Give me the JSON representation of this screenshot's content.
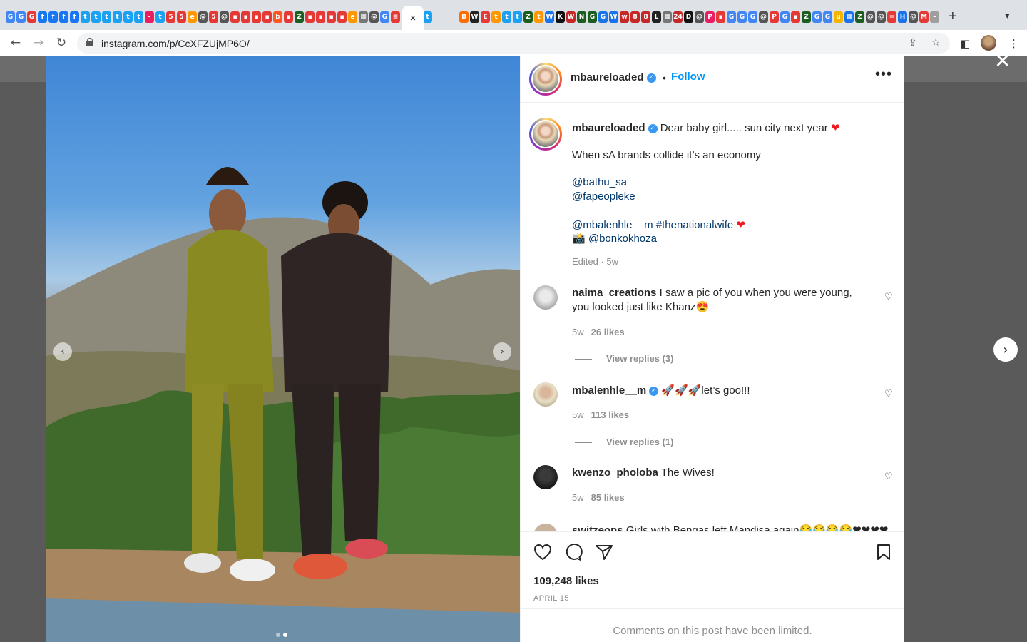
{
  "browser": {
    "url": "instagram.com/p/CcXFZUjMP6O/",
    "close_tab": "×",
    "new_tab": "+",
    "tab_menu": "⌄",
    "tab_favicons": [
      {
        "c": "#4285f4",
        "g": "G"
      },
      {
        "c": "#4285f4",
        "g": "G"
      },
      {
        "c": "#e53935",
        "g": "G"
      },
      {
        "c": "#1877f2",
        "g": "f"
      },
      {
        "c": "#1877f2",
        "g": "f"
      },
      {
        "c": "#1877f2",
        "g": "f"
      },
      {
        "c": "#1877f2",
        "g": "f"
      },
      {
        "c": "#1da1f2",
        "g": "t"
      },
      {
        "c": "#1da1f2",
        "g": "t"
      },
      {
        "c": "#1da1f2",
        "g": "t"
      },
      {
        "c": "#1da1f2",
        "g": "t"
      },
      {
        "c": "#1da1f2",
        "g": "t"
      },
      {
        "c": "#1da1f2",
        "g": "t"
      },
      {
        "c": "#e91e63",
        "g": "-"
      },
      {
        "c": "#1da1f2",
        "g": "t"
      },
      {
        "c": "#e53935",
        "g": "5"
      },
      {
        "c": "#e53935",
        "g": "5"
      },
      {
        "c": "#ff9800",
        "g": "e"
      },
      {
        "c": "#555555",
        "g": "@"
      },
      {
        "c": "#e53935",
        "g": "5"
      },
      {
        "c": "#555555",
        "g": "@"
      },
      {
        "c": "#e53935",
        "g": "▪"
      },
      {
        "c": "#e53935",
        "g": "▪"
      },
      {
        "c": "#e53935",
        "g": "▪"
      },
      {
        "c": "#e53935",
        "g": "▪"
      },
      {
        "c": "#ff5722",
        "g": "b"
      },
      {
        "c": "#e53935",
        "g": "▪"
      },
      {
        "c": "#1b5e20",
        "g": "Z"
      },
      {
        "c": "#e53935",
        "g": "▪"
      },
      {
        "c": "#e53935",
        "g": "▪"
      },
      {
        "c": "#e53935",
        "g": "▪"
      },
      {
        "c": "#e53935",
        "g": "▪"
      },
      {
        "c": "#ff9800",
        "g": "e"
      },
      {
        "c": "#777777",
        "g": "▦"
      },
      {
        "c": "#555555",
        "g": "@"
      },
      {
        "c": "#4285f4",
        "g": "G"
      },
      {
        "c": "#e53935",
        "g": "≡"
      },
      {
        "c": "#f4b400",
        "g": "a"
      },
      {
        "c": "#555555",
        "g": "@"
      },
      {
        "c": "#1da1f2",
        "g": "t"
      }
    ],
    "tab_favicons_right": [
      {
        "c": "#ff6f00",
        "g": "B"
      },
      {
        "c": "#222222",
        "g": "W"
      },
      {
        "c": "#e53935",
        "g": "E"
      },
      {
        "c": "#ff9800",
        "g": "t"
      },
      {
        "c": "#1da1f2",
        "g": "t"
      },
      {
        "c": "#1da1f2",
        "g": "t"
      },
      {
        "c": "#1b5e20",
        "g": "Z"
      },
      {
        "c": "#ff9800",
        "g": "t"
      },
      {
        "c": "#1a73e8",
        "g": "W"
      },
      {
        "c": "#111111",
        "g": "K"
      },
      {
        "c": "#c62828",
        "g": "W"
      },
      {
        "c": "#1b5e20",
        "g": "N"
      },
      {
        "c": "#1b5e20",
        "g": "G"
      },
      {
        "c": "#1a73e8",
        "g": "G"
      },
      {
        "c": "#1a73e8",
        "g": "W"
      },
      {
        "c": "#c62828",
        "g": "w"
      },
      {
        "c": "#c62828",
        "g": "8"
      },
      {
        "c": "#c62828",
        "g": "8"
      },
      {
        "c": "#222222",
        "g": "L"
      },
      {
        "c": "#777777",
        "g": "▦"
      },
      {
        "c": "#c62828",
        "g": "24"
      },
      {
        "c": "#111111",
        "g": "D"
      },
      {
        "c": "#555555",
        "g": "@"
      },
      {
        "c": "#e91e63",
        "g": "P"
      },
      {
        "c": "#e53935",
        "g": "▪"
      },
      {
        "c": "#4285f4",
        "g": "G"
      },
      {
        "c": "#4285f4",
        "g": "G"
      },
      {
        "c": "#4285f4",
        "g": "G"
      },
      {
        "c": "#555555",
        "g": "@"
      },
      {
        "c": "#e53935",
        "g": "P"
      },
      {
        "c": "#4285f4",
        "g": "G"
      },
      {
        "c": "#e53935",
        "g": "▪"
      },
      {
        "c": "#1b5e20",
        "g": "Z"
      },
      {
        "c": "#4285f4",
        "g": "G"
      },
      {
        "c": "#4285f4",
        "g": "G"
      },
      {
        "c": "#f4b400",
        "g": "u"
      },
      {
        "c": "#1a73e8",
        "g": "▦"
      },
      {
        "c": "#1b5e20",
        "g": "Z"
      },
      {
        "c": "#555555",
        "g": "@"
      },
      {
        "c": "#555555",
        "g": "@"
      },
      {
        "c": "#e53935",
        "g": "="
      },
      {
        "c": "#1a73e8",
        "g": "H"
      },
      {
        "c": "#555555",
        "g": "@"
      },
      {
        "c": "#e53935",
        "g": "M"
      },
      {
        "c": "#9e9e9e",
        "g": "–"
      },
      {
        "c": "#c62828",
        "g": "m"
      },
      {
        "c": "#2e7d32",
        "g": "25"
      },
      {
        "c": "#111111",
        "g": "B"
      }
    ]
  },
  "post": {
    "username": "mbaureloaded",
    "follow_label": "Follow",
    "separator": "•",
    "more_label": "•••",
    "caption": {
      "line1": "Dear baby girl..... sun city next year",
      "line2": "When sA brands collide it’s an economy",
      "mention1": "@bathu_sa",
      "mention2": "@fapeopleke",
      "mention3": "@mbalenhle__m",
      "hashtag": "#thenationalwife",
      "camera": "📸",
      "mention4": "@bonkokhoza",
      "heart": "❤",
      "meta": "Edited · 5w"
    },
    "comments": [
      {
        "user": "naima_creations",
        "text1": "I saw a pic of you when you were young,",
        "text2": "you looked just like Khanz😍",
        "age": "5w",
        "likes": "26 likes",
        "replies": "View replies (3)"
      },
      {
        "user": "mbalenhle__m",
        "text1": "🚀🚀🚀let’s goo!!!",
        "age": "5w",
        "likes": "113 likes",
        "replies": "View replies (1)"
      },
      {
        "user": "kwenzo_pholoba",
        "text1": "The Wives!",
        "age": "5w",
        "likes": "85 likes"
      },
      {
        "user": "switzeons",
        "text1": "Girls with Bengas left Mandisa again😂😂😂😂❤❤❤❤"
      }
    ],
    "likes": "109,248 likes",
    "date": "APRIL 15",
    "limited_note": "Comments on this post have been limited."
  },
  "colors": {
    "accent": "#0095f6",
    "verified": "#3897f0",
    "mention": "#00376b",
    "muted": "#8e8e8e"
  }
}
